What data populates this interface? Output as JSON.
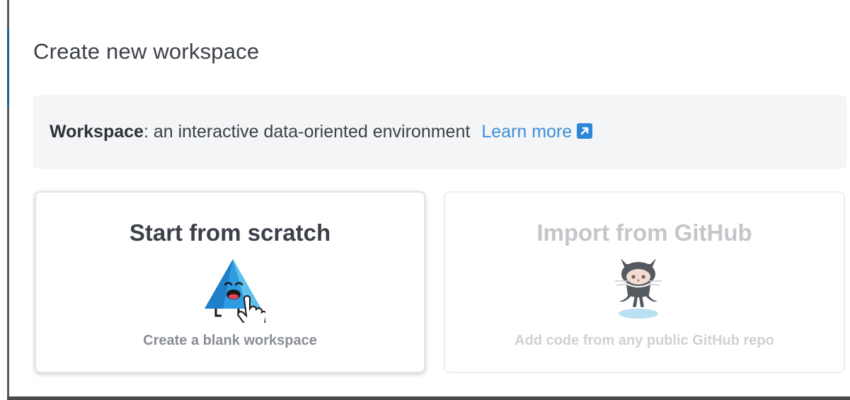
{
  "dialog": {
    "title": "Create new workspace",
    "info": {
      "term": "Workspace",
      "definition": ": an interactive data-oriented environment",
      "learn_more": "Learn more"
    }
  },
  "cards": {
    "scratch": {
      "title": "Start from scratch",
      "subtitle": "Create a blank workspace",
      "icon": "triangle-mascot-icon"
    },
    "github": {
      "title": "Import from GitHub",
      "subtitle": "Add code from any public GitHub repo",
      "icon": "octocat-icon"
    }
  },
  "colors": {
    "link": "#3d8fd9",
    "title_text": "#3c4048",
    "disabled_text": "#c4c6ca",
    "mascot_blue": "#2f9be0"
  }
}
